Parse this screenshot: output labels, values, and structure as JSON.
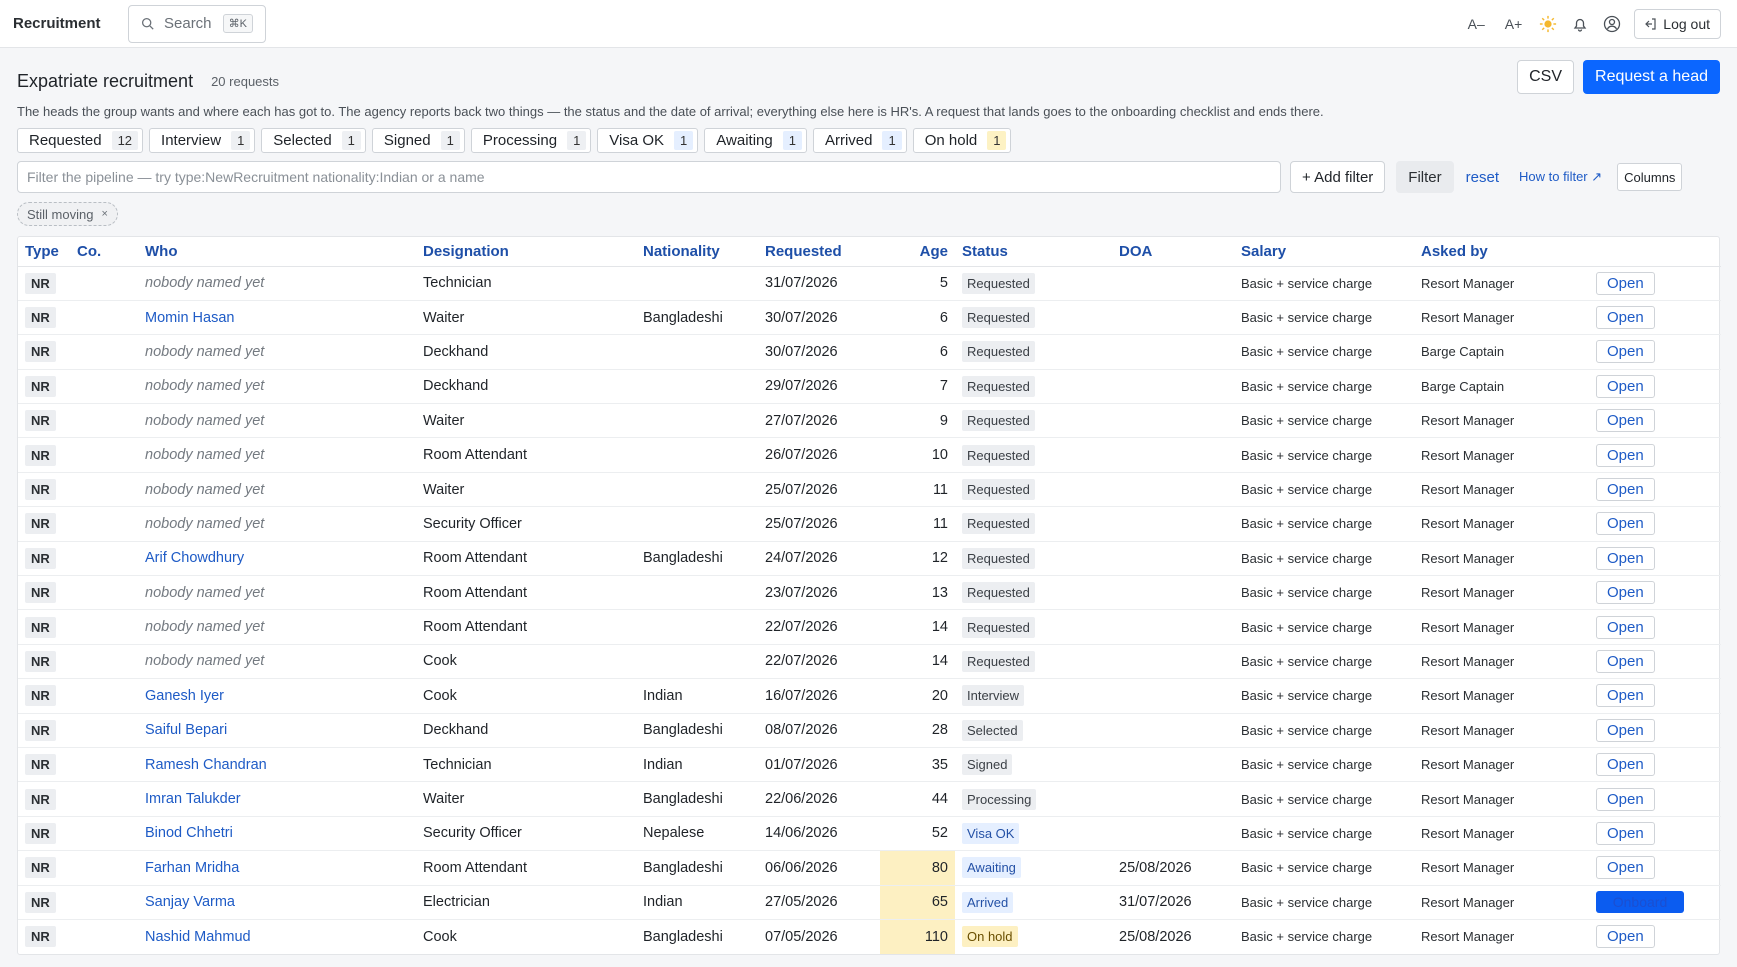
{
  "app": {
    "title": "Recruitment"
  },
  "search": {
    "label": "Search",
    "shortcut": "⌘K"
  },
  "topbar": {
    "text_smaller": "A–",
    "text_larger": "A+",
    "logout_label": "Log out"
  },
  "header": {
    "title": "Expatriate recruitment",
    "count": "20 requests",
    "csv_label": "CSV",
    "request_label": "Request a head",
    "description": "The heads the group wants and where each has got to. The agency reports back two things — the status and the date of arrival; everything else here is HR's. A request that lands goes to the onboarding checklist and ends there."
  },
  "stages": [
    {
      "label": "Requested",
      "count": "12",
      "tone": "grey"
    },
    {
      "label": "Interview",
      "count": "1",
      "tone": "grey"
    },
    {
      "label": "Selected",
      "count": "1",
      "tone": "grey"
    },
    {
      "label": "Signed",
      "count": "1",
      "tone": "grey"
    },
    {
      "label": "Processing",
      "count": "1",
      "tone": "grey"
    },
    {
      "label": "Visa OK",
      "count": "1",
      "tone": "blue"
    },
    {
      "label": "Awaiting",
      "count": "1",
      "tone": "blue"
    },
    {
      "label": "Arrived",
      "count": "1",
      "tone": "blue"
    },
    {
      "label": "On hold",
      "count": "1",
      "tone": "yellow"
    }
  ],
  "filter": {
    "placeholder": "Filter the pipeline — try type:NewRecruitment nationality:Indian or a name",
    "add_filter_label": "+ Add filter",
    "filter_label": "Filter",
    "reset_label": "reset",
    "how_label": "How to filter ↗",
    "columns_label": "Columns",
    "active_tag": "Still moving",
    "tag_remove": "×"
  },
  "table": {
    "headers": [
      "Type",
      "Co.",
      "Who",
      "Designation",
      "Nationality",
      "Requested",
      "Age",
      "Status",
      "DOA",
      "Salary",
      "Asked by",
      ""
    ],
    "open_label": "Open",
    "onboard_label": "Onboard",
    "rows": [
      {
        "type": "NR",
        "co": "",
        "who": "nobody named yet",
        "named": false,
        "designation": "Technician",
        "nationality": "",
        "requested": "31/07/2026",
        "age": "5",
        "hot": false,
        "status": "Requested",
        "tone": "grey",
        "doa": "",
        "salary": "Basic + service charge",
        "asked_by": "Resort Manager",
        "action": "open"
      },
      {
        "type": "NR",
        "co": "",
        "who": "Momin Hasan",
        "named": true,
        "designation": "Waiter",
        "nationality": "Bangladeshi",
        "requested": "30/07/2026",
        "age": "6",
        "hot": false,
        "status": "Requested",
        "tone": "grey",
        "doa": "",
        "salary": "Basic + service charge",
        "asked_by": "Resort Manager",
        "action": "open"
      },
      {
        "type": "NR",
        "co": "",
        "who": "nobody named yet",
        "named": false,
        "designation": "Deckhand",
        "nationality": "",
        "requested": "30/07/2026",
        "age": "6",
        "hot": false,
        "status": "Requested",
        "tone": "grey",
        "doa": "",
        "salary": "Basic + service charge",
        "asked_by": "Barge Captain",
        "action": "open"
      },
      {
        "type": "NR",
        "co": "",
        "who": "nobody named yet",
        "named": false,
        "designation": "Deckhand",
        "nationality": "",
        "requested": "29/07/2026",
        "age": "7",
        "hot": false,
        "status": "Requested",
        "tone": "grey",
        "doa": "",
        "salary": "Basic + service charge",
        "asked_by": "Barge Captain",
        "action": "open"
      },
      {
        "type": "NR",
        "co": "",
        "who": "nobody named yet",
        "named": false,
        "designation": "Waiter",
        "nationality": "",
        "requested": "27/07/2026",
        "age": "9",
        "hot": false,
        "status": "Requested",
        "tone": "grey",
        "doa": "",
        "salary": "Basic + service charge",
        "asked_by": "Resort Manager",
        "action": "open"
      },
      {
        "type": "NR",
        "co": "",
        "who": "nobody named yet",
        "named": false,
        "designation": "Room Attendant",
        "nationality": "",
        "requested": "26/07/2026",
        "age": "10",
        "hot": false,
        "status": "Requested",
        "tone": "grey",
        "doa": "",
        "salary": "Basic + service charge",
        "asked_by": "Resort Manager",
        "action": "open"
      },
      {
        "type": "NR",
        "co": "",
        "who": "nobody named yet",
        "named": false,
        "designation": "Waiter",
        "nationality": "",
        "requested": "25/07/2026",
        "age": "11",
        "hot": false,
        "status": "Requested",
        "tone": "grey",
        "doa": "",
        "salary": "Basic + service charge",
        "asked_by": "Resort Manager",
        "action": "open"
      },
      {
        "type": "NR",
        "co": "",
        "who": "nobody named yet",
        "named": false,
        "designation": "Security Officer",
        "nationality": "",
        "requested": "25/07/2026",
        "age": "11",
        "hot": false,
        "status": "Requested",
        "tone": "grey",
        "doa": "",
        "salary": "Basic + service charge",
        "asked_by": "Resort Manager",
        "action": "open"
      },
      {
        "type": "NR",
        "co": "",
        "who": "Arif Chowdhury",
        "named": true,
        "designation": "Room Attendant",
        "nationality": "Bangladeshi",
        "requested": "24/07/2026",
        "age": "12",
        "hot": false,
        "status": "Requested",
        "tone": "grey",
        "doa": "",
        "salary": "Basic + service charge",
        "asked_by": "Resort Manager",
        "action": "open"
      },
      {
        "type": "NR",
        "co": "",
        "who": "nobody named yet",
        "named": false,
        "designation": "Room Attendant",
        "nationality": "",
        "requested": "23/07/2026",
        "age": "13",
        "hot": false,
        "status": "Requested",
        "tone": "grey",
        "doa": "",
        "salary": "Basic + service charge",
        "asked_by": "Resort Manager",
        "action": "open"
      },
      {
        "type": "NR",
        "co": "",
        "who": "nobody named yet",
        "named": false,
        "designation": "Room Attendant",
        "nationality": "",
        "requested": "22/07/2026",
        "age": "14",
        "hot": false,
        "status": "Requested",
        "tone": "grey",
        "doa": "",
        "salary": "Basic + service charge",
        "asked_by": "Resort Manager",
        "action": "open"
      },
      {
        "type": "NR",
        "co": "",
        "who": "nobody named yet",
        "named": false,
        "designation": "Cook",
        "nationality": "",
        "requested": "22/07/2026",
        "age": "14",
        "hot": false,
        "status": "Requested",
        "tone": "grey",
        "doa": "",
        "salary": "Basic + service charge",
        "asked_by": "Resort Manager",
        "action": "open"
      },
      {
        "type": "NR",
        "co": "",
        "who": "Ganesh Iyer",
        "named": true,
        "designation": "Cook",
        "nationality": "Indian",
        "requested": "16/07/2026",
        "age": "20",
        "hot": false,
        "status": "Interview",
        "tone": "grey",
        "doa": "",
        "salary": "Basic + service charge",
        "asked_by": "Resort Manager",
        "action": "open"
      },
      {
        "type": "NR",
        "co": "",
        "who": "Saiful Bepari",
        "named": true,
        "designation": "Deckhand",
        "nationality": "Bangladeshi",
        "requested": "08/07/2026",
        "age": "28",
        "hot": false,
        "status": "Selected",
        "tone": "grey",
        "doa": "",
        "salary": "Basic + service charge",
        "asked_by": "Resort Manager",
        "action": "open"
      },
      {
        "type": "NR",
        "co": "",
        "who": "Ramesh Chandran",
        "named": true,
        "designation": "Technician",
        "nationality": "Indian",
        "requested": "01/07/2026",
        "age": "35",
        "hot": false,
        "status": "Signed",
        "tone": "grey",
        "doa": "",
        "salary": "Basic + service charge",
        "asked_by": "Resort Manager",
        "action": "open"
      },
      {
        "type": "NR",
        "co": "",
        "who": "Imran Talukder",
        "named": true,
        "designation": "Waiter",
        "nationality": "Bangladeshi",
        "requested": "22/06/2026",
        "age": "44",
        "hot": false,
        "status": "Processing",
        "tone": "grey",
        "doa": "",
        "salary": "Basic + service charge",
        "asked_by": "Resort Manager",
        "action": "open"
      },
      {
        "type": "NR",
        "co": "",
        "who": "Binod Chhetri",
        "named": true,
        "designation": "Security Officer",
        "nationality": "Nepalese",
        "requested": "14/06/2026",
        "age": "52",
        "hot": false,
        "status": "Visa OK",
        "tone": "blue",
        "doa": "",
        "salary": "Basic + service charge",
        "asked_by": "Resort Manager",
        "action": "open"
      },
      {
        "type": "NR",
        "co": "",
        "who": "Farhan Mridha",
        "named": true,
        "designation": "Room Attendant",
        "nationality": "Bangladeshi",
        "requested": "06/06/2026",
        "age": "80",
        "hot": true,
        "status": "Awaiting",
        "tone": "blue",
        "doa": "25/08/2026",
        "salary": "Basic + service charge",
        "asked_by": "Resort Manager",
        "action": "open"
      },
      {
        "type": "NR",
        "co": "",
        "who": "Sanjay Varma",
        "named": true,
        "designation": "Electrician",
        "nationality": "Indian",
        "requested": "27/05/2026",
        "age": "65",
        "hot": true,
        "status": "Arrived",
        "tone": "blue",
        "doa": "31/07/2026",
        "salary": "Basic + service charge",
        "asked_by": "Resort Manager",
        "action": "onboard"
      },
      {
        "type": "NR",
        "co": "",
        "who": "Nashid Mahmud",
        "named": true,
        "designation": "Cook",
        "nationality": "Bangladeshi",
        "requested": "07/05/2026",
        "age": "110",
        "hot": true,
        "status": "On hold",
        "tone": "yellow",
        "doa": "25/08/2026",
        "salary": "Basic + service charge",
        "asked_by": "Resort Manager",
        "action": "open"
      }
    ]
  }
}
